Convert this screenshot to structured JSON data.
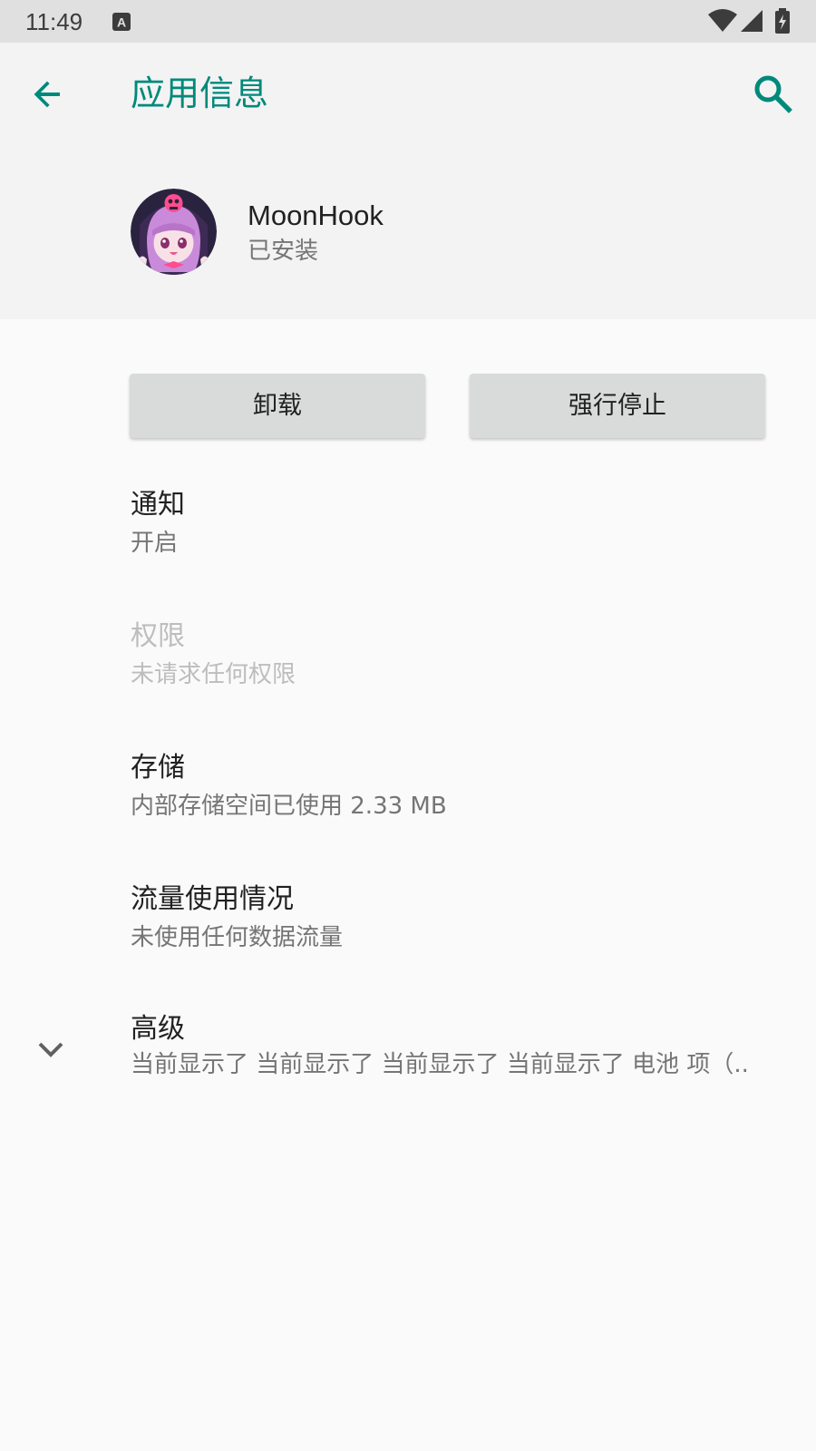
{
  "status_bar": {
    "time": "11:49",
    "notification_icon": "a-letter-icon",
    "icons": [
      "wifi-icon",
      "signal-icon",
      "battery-charging-icon"
    ]
  },
  "toolbar": {
    "title": "应用信息",
    "back_icon": "arrow-back-icon",
    "search_icon": "search-icon",
    "accent_color": "#00897b"
  },
  "app": {
    "name": "MoonHook",
    "status": "已安装",
    "icon": "app-avatar-icon"
  },
  "buttons": {
    "uninstall": "卸载",
    "force_stop": "强行停止"
  },
  "prefs": [
    {
      "title": "通知",
      "summary": "开启",
      "enabled": true
    },
    {
      "title": "权限",
      "summary": "未请求任何权限",
      "enabled": false
    },
    {
      "title": "存储",
      "summary": "内部存储空间已使用 2.33 MB",
      "enabled": true
    },
    {
      "title": "流量使用情况",
      "summary": "未使用任何数据流量",
      "enabled": true
    },
    {
      "title": "高级",
      "summary": "当前显示了 当前显示了 当前显示了 当前显示了 电池 项（..",
      "enabled": true
    }
  ]
}
